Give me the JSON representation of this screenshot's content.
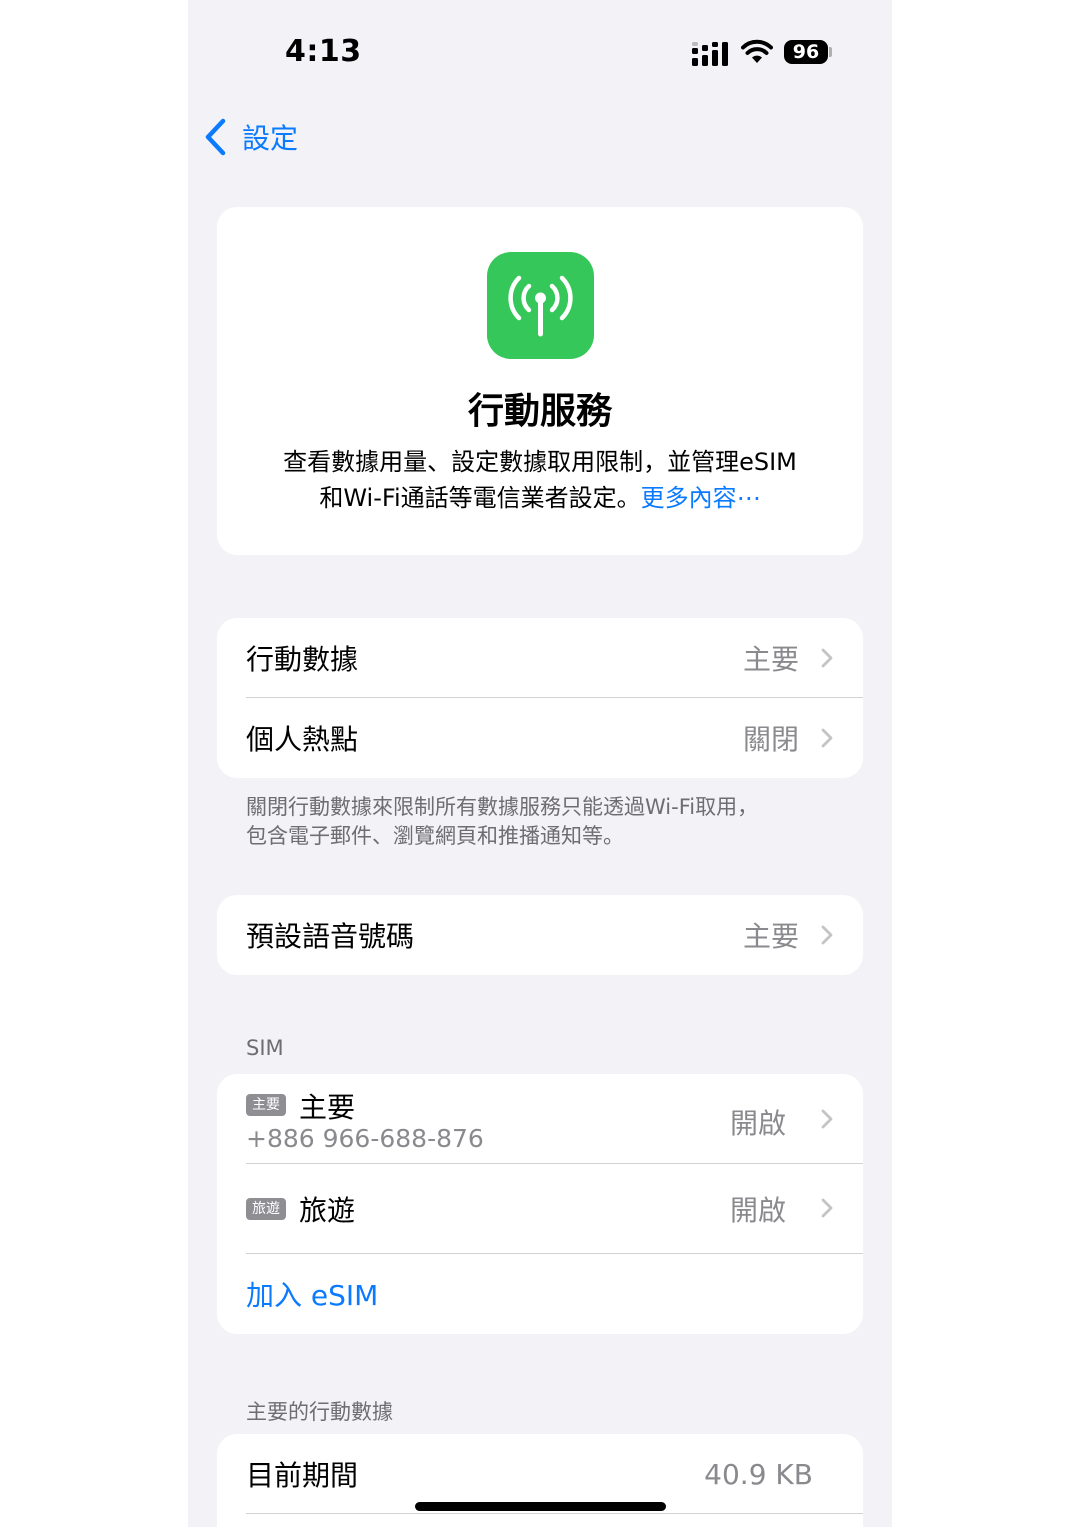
{
  "status_bar": {
    "time": "4:13",
    "battery": "96",
    "icons": [
      "cellular-signal-icon",
      "wifi-icon",
      "battery-icon"
    ]
  },
  "nav": {
    "back_label": "設定",
    "back_icon": "chevron-left-icon"
  },
  "hero": {
    "icon": "antenna-icon",
    "icon_color": "#35c759",
    "title": "行動服務",
    "description_line1": "查看數據用量、設定數據取用限制，並管理eSIM",
    "description_line2": "和Wi-Fi通話等電信業者設定。",
    "more_link": "更多內容⋯"
  },
  "cellular_group": {
    "rows": [
      {
        "label": "行動數據",
        "value": "主要"
      },
      {
        "label": "個人熱點",
        "value": "關閉"
      }
    ],
    "footnote_line1": "關閉行動數據來限制所有數據服務只能透過Wi-Fi取用，",
    "footnote_line2": "包含電子郵件、瀏覽網頁和推播通知等。"
  },
  "voice_group": {
    "label": "預設語音號碼",
    "value": "主要"
  },
  "sim_section": {
    "header": "SIM",
    "sims": [
      {
        "badge": "主要",
        "name": "主要",
        "number": "+886 966-688-876",
        "value": "開啟"
      },
      {
        "badge": "旅遊",
        "name": "旅遊",
        "value": "開啟"
      }
    ],
    "add_esim": "加入 eSIM"
  },
  "usage_section": {
    "header": "主要的行動數據",
    "rows": [
      {
        "label": "目前期間",
        "value": "40.9 KB"
      }
    ]
  },
  "colors": {
    "accent": "#0a7aff",
    "background": "#f2f2f7",
    "secondary_text": "#8a8a8e"
  }
}
